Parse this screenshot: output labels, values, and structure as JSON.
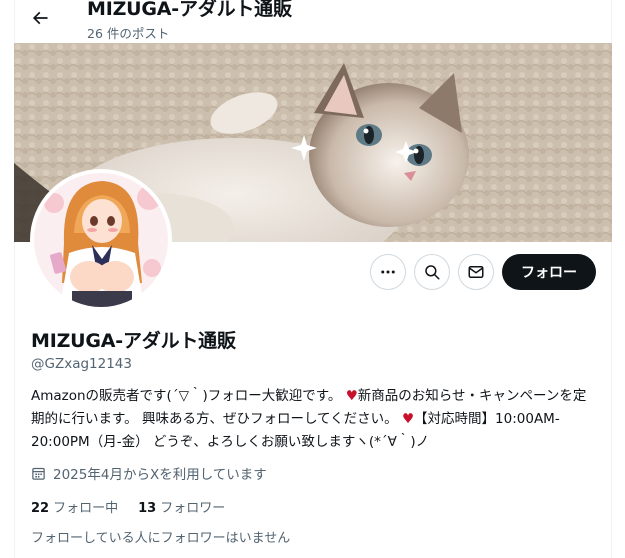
{
  "header": {
    "back_icon": "arrow-left-icon",
    "name": "MIZUGA-アダルト通販",
    "post_count": "26 件のポスト"
  },
  "banner": {
    "subject": "cat-photo"
  },
  "avatar": {
    "subject": "anime-illustration-avatar"
  },
  "actions": {
    "more_icon": "more-horizontal-icon",
    "search_icon": "search-icon",
    "message_icon": "envelope-icon",
    "follow_label": "フォロー"
  },
  "profile": {
    "name": "MIZUGA-アダルト通販",
    "handle": "@GZxag12143",
    "bio": {
      "part1": "Amazonの販売者です(´▽｀)フォロー大歓迎です。",
      "heart1": "♥",
      "part2": "新商品のお知らせ・キャンペーンを定期的に行います。 興味ある方、ぜひフォローしてください。",
      "heart2": "♥",
      "part3": "【対応時間】10:00AM-20:00PM（月-金） どうぞ、よろしくお願い致しますヽ(*´∀｀)ノ"
    },
    "joined": "2025年4月からXを利用しています",
    "following_count": "22",
    "following_label": "フォロー中",
    "followers_count": "13",
    "followers_label": "フォロワー",
    "followers_note": "フォローしている人にフォロワーはいません"
  },
  "colors": {
    "accent_dark": "#0f1419",
    "secondary_text": "#536471",
    "heart": "#c8102e",
    "border": "#cfd9de"
  }
}
